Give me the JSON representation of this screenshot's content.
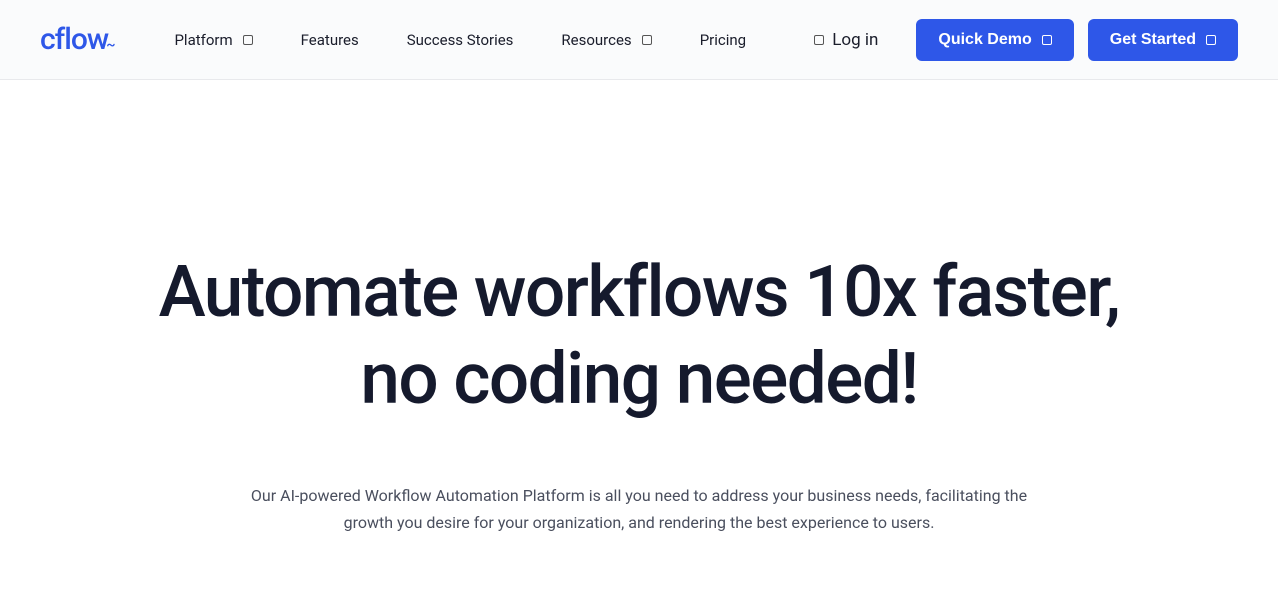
{
  "brand": {
    "name": "cflow"
  },
  "nav": {
    "items": [
      {
        "label": "Platform",
        "has_dropdown": true
      },
      {
        "label": "Features",
        "has_dropdown": false
      },
      {
        "label": "Success Stories",
        "has_dropdown": false
      },
      {
        "label": "Resources",
        "has_dropdown": true
      },
      {
        "label": "Pricing",
        "has_dropdown": false
      }
    ]
  },
  "header": {
    "login_label": "Log in",
    "quick_demo_label": "Quick Demo",
    "get_started_label": "Get Started"
  },
  "hero": {
    "title": "Automate workflows 10x faster, no coding needed!",
    "subtitle": "Our AI-powered Workflow Automation Platform is all you need to address your business needs, facilitating the growth you desire for your organization, and rendering the best experience to users."
  },
  "colors": {
    "primary": "#2e57e8",
    "text_dark": "#151a2d"
  }
}
